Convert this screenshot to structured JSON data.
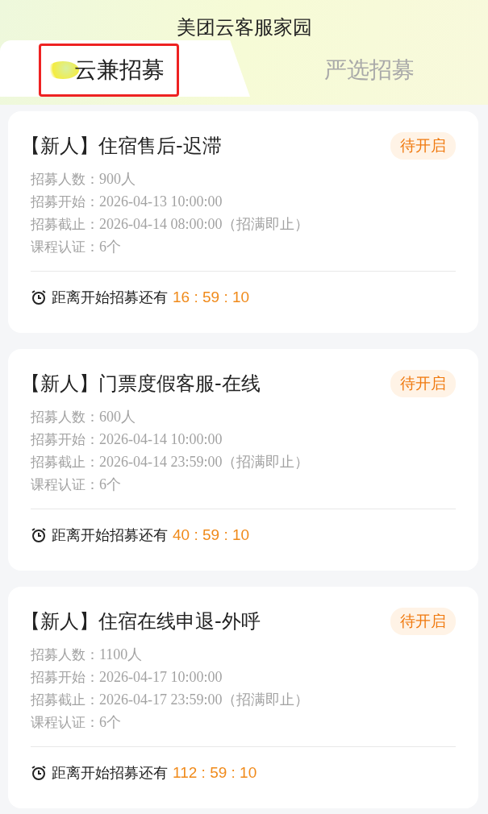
{
  "header": {
    "title": "美团云客服家园"
  },
  "tabs": [
    {
      "label": "云兼招募",
      "selected": true
    },
    {
      "label": "严选招募",
      "selected": false
    }
  ],
  "cards": [
    {
      "title": "【新人】住宿售后-迟滞",
      "status": "待开启",
      "fields": [
        {
          "label": "招募人数：",
          "value": "900人"
        },
        {
          "label": "招募开始：",
          "value": "2026-04-13 10:00:00"
        },
        {
          "label": "招募截止：",
          "value": "2026-04-14 08:00:00（招满即止）"
        },
        {
          "label": "课程认证：",
          "value": "6个"
        }
      ],
      "countdown_label": "距离开始招募还有",
      "countdown": "16 : 59 : 10"
    },
    {
      "title": "【新人】门票度假客服-在线",
      "status": "待开启",
      "fields": [
        {
          "label": "招募人数：",
          "value": "600人"
        },
        {
          "label": "招募开始：",
          "value": "2026-04-14 10:00:00"
        },
        {
          "label": "招募截止：",
          "value": "2026-04-14 23:59:00（招满即止）"
        },
        {
          "label": "课程认证：",
          "value": "6个"
        }
      ],
      "countdown_label": "距离开始招募还有",
      "countdown": "40 : 59 : 10"
    },
    {
      "title": "【新人】住宿在线申退-外呼",
      "status": "待开启",
      "fields": [
        {
          "label": "招募人数：",
          "value": "1100人"
        },
        {
          "label": "招募开始：",
          "value": "2026-04-17 10:00:00"
        },
        {
          "label": "招募截止：",
          "value": "2026-04-17 23:59:00（招满即止）"
        },
        {
          "label": "课程认证：",
          "value": "6个"
        }
      ],
      "countdown_label": "距离开始招募还有",
      "countdown": "112 : 59 : 10"
    }
  ]
}
